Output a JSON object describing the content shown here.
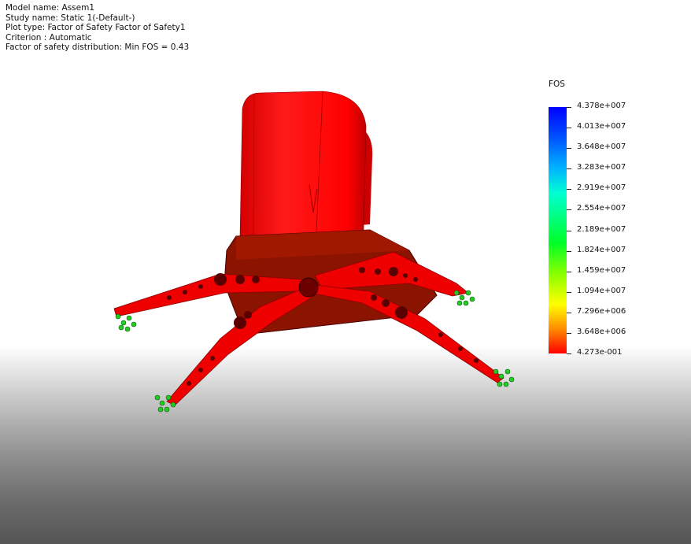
{
  "info": {
    "model_name": "Model name: Assem1",
    "study_name": "Study name: Static 1(-Default-)",
    "plot_type": "Plot type: Factor of Safety Factor of Safety1",
    "criterion": "Criterion : Automatic",
    "distribution": "Factor of safety distribution: Min FOS = 0.43"
  },
  "legend": {
    "title": "FOS",
    "labels": [
      "4.378e+007",
      "4.013e+007",
      "3.648e+007",
      "3.283e+007",
      "2.919e+007",
      "2.554e+007",
      "2.189e+007",
      "1.824e+007",
      "1.459e+007",
      "1.094e+007",
      "7.296e+006",
      "3.648e+006",
      "4.273e-001"
    ],
    "colors": {
      "max": "#0000ff",
      "min": "#ff0000"
    }
  },
  "model": {
    "body_color": "#ff0000",
    "fixture_color": "#22cc22"
  }
}
